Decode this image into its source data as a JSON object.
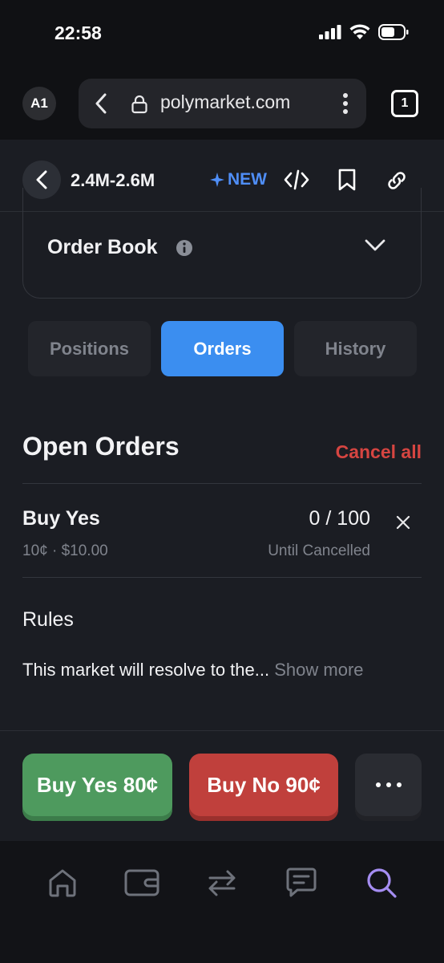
{
  "status": {
    "time": "22:58"
  },
  "browser": {
    "profile": "A1",
    "url": "polymarket.com",
    "tab_count": "1"
  },
  "appbar": {
    "title": "2.4M-2.6M",
    "new_label": "NEW"
  },
  "order_book": {
    "title": "Order Book"
  },
  "tabs": [
    {
      "label": "Positions",
      "active": false
    },
    {
      "label": "Orders",
      "active": true
    },
    {
      "label": "History",
      "active": false
    }
  ],
  "open_orders": {
    "title": "Open Orders",
    "cancel_all": "Cancel all",
    "orders": [
      {
        "side": "Buy Yes",
        "fill": "0 / 100",
        "detail": "10¢ · $10.00",
        "expiry": "Until Cancelled"
      }
    ]
  },
  "rules": {
    "title": "Rules",
    "text": "This market will resolve to the...",
    "show_more": "Show more"
  },
  "trade": {
    "buy_yes": "Buy Yes 80¢",
    "buy_no": "Buy No 90¢"
  },
  "nav": [
    "home-icon",
    "wallet-icon",
    "swap-icon",
    "chat-icon",
    "search-icon"
  ],
  "colors": {
    "accent": "#3b8ef0",
    "yes": "#4e9a5e",
    "no": "#c0403c",
    "danger": "#d64541",
    "nav_active": "#a58df2"
  }
}
